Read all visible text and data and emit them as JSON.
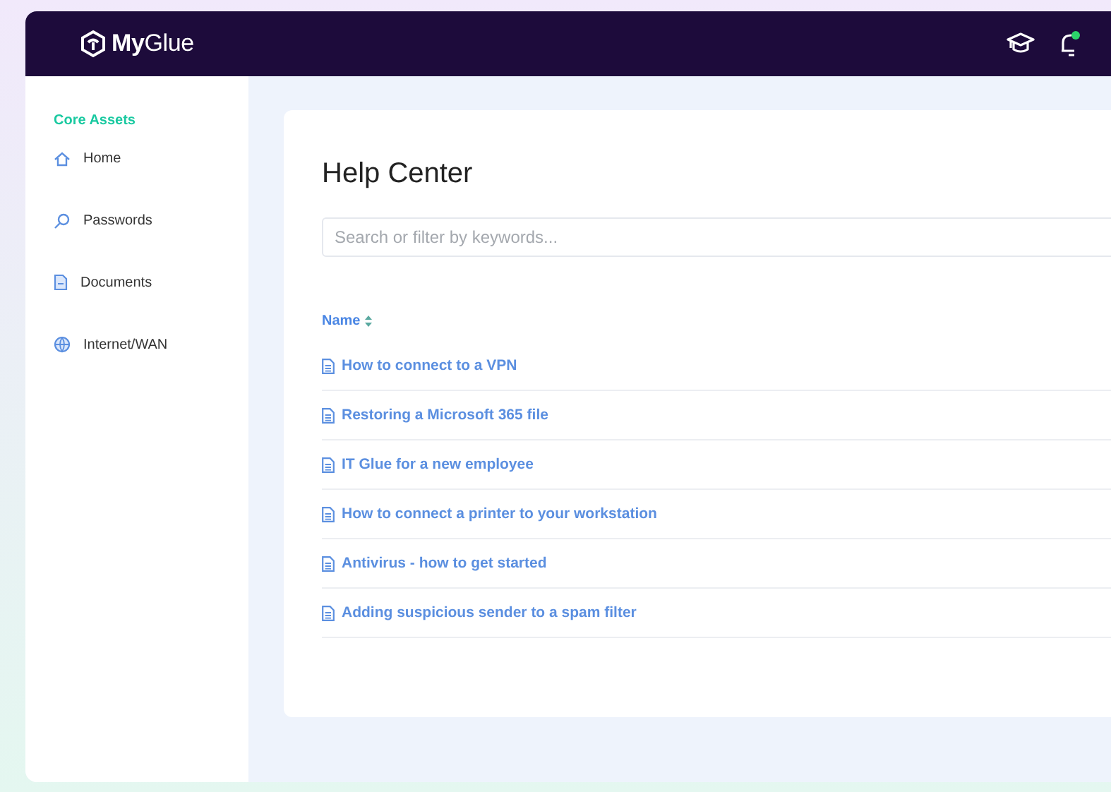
{
  "header": {
    "logo": "**My**Glue"
  },
  "sidebar": {
    "section": "Core Assets",
    "items": [
      {
        "label": "Home"
      },
      {
        "label": "Passwords"
      },
      {
        "label": "Documents"
      },
      {
        "label": "Internet/WAN"
      }
    ]
  },
  "main": {
    "title": "Help Center",
    "search": {
      "placeholder": "Search or filter by keywords..."
    },
    "table": {
      "columns": [
        "Name"
      ],
      "rows": [
        "How to connect to a VPN",
        "Restoring a Microsoft 365 file",
        "IT Glue for a new employee",
        "How to connect a printer to your workstation",
        "Antivirus - how to get started",
        "Adding suspicious sender to a spam filter"
      ]
    }
  }
}
